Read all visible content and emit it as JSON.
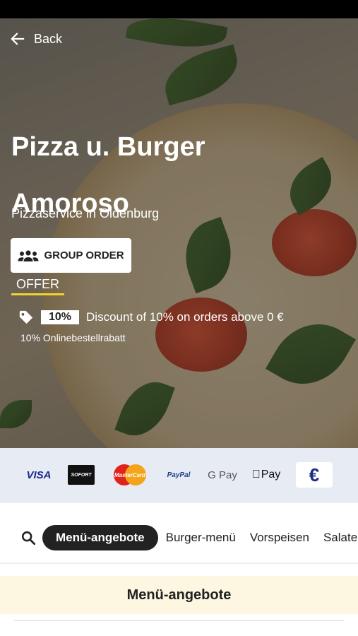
{
  "header": {
    "back_label": "Back"
  },
  "restaurant": {
    "name_line1": "Pizza u. Burger",
    "name_line2": "Amoroso",
    "subtitle": "Pizzaservice in Oldenburg"
  },
  "actions": {
    "group_order_label": "GROUP ORDER"
  },
  "offer": {
    "label": "OFFER",
    "percent_badge": "10%",
    "description": "Discount of 10% on orders above 0 €",
    "subtext": "10% Onlinebestellrabatt"
  },
  "payments": {
    "visa": "VISA",
    "sofort": "SOFORT",
    "mastercard": "MasterCard",
    "paypal": "PayPal",
    "gpay": "G Pay",
    "applepay": "Pay",
    "cash": "€"
  },
  "categories": {
    "tabs": [
      "Menü-angebote",
      "Burger-menü",
      "Vorspeisen",
      "Salate"
    ],
    "active_index": 0
  },
  "section": {
    "title": "Menü-angebote"
  },
  "colors": {
    "offer_underline": "#f2d32d",
    "payments_bg": "#e7ebf3",
    "section_bg": "#fdf7e1",
    "active_tab_bg": "#222222"
  }
}
